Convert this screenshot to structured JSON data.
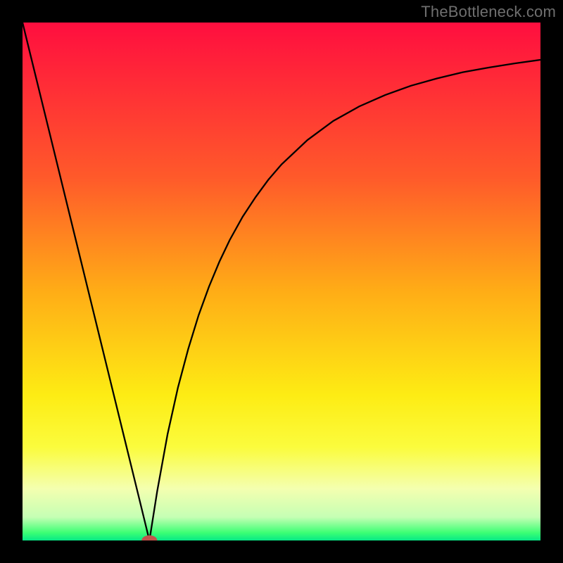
{
  "watermark": "TheBottleneck.com",
  "chart_data": {
    "type": "line",
    "title": "",
    "xlabel": "",
    "ylabel": "",
    "xlim": [
      0,
      1
    ],
    "ylim": [
      0,
      1
    ],
    "grid": false,
    "legend": false,
    "gradient_stops": [
      {
        "offset": 0.0,
        "color": "#ff0e3f"
      },
      {
        "offset": 0.3,
        "color": "#ff5a2a"
      },
      {
        "offset": 0.52,
        "color": "#ffad16"
      },
      {
        "offset": 0.72,
        "color": "#fdec14"
      },
      {
        "offset": 0.82,
        "color": "#fbfc3d"
      },
      {
        "offset": 0.9,
        "color": "#f4ffb0"
      },
      {
        "offset": 0.955,
        "color": "#c5ffb4"
      },
      {
        "offset": 0.985,
        "color": "#3cff74"
      },
      {
        "offset": 1.0,
        "color": "#06e886"
      }
    ],
    "minimum_x": 0.245,
    "series": [
      {
        "name": "bottleneck-curve",
        "color": "#000000",
        "width": 2.3,
        "x": [
          0.0,
          0.025,
          0.05,
          0.075,
          0.1,
          0.125,
          0.15,
          0.175,
          0.2,
          0.225,
          0.245,
          0.26,
          0.28,
          0.3,
          0.32,
          0.34,
          0.36,
          0.38,
          0.4,
          0.425,
          0.45,
          0.475,
          0.5,
          0.55,
          0.6,
          0.65,
          0.7,
          0.75,
          0.8,
          0.85,
          0.9,
          0.95,
          1.0
        ],
        "y": [
          1.0,
          0.898,
          0.796,
          0.694,
          0.592,
          0.49,
          0.388,
          0.286,
          0.184,
          0.082,
          0.0,
          0.095,
          0.205,
          0.295,
          0.37,
          0.435,
          0.49,
          0.538,
          0.58,
          0.625,
          0.663,
          0.697,
          0.726,
          0.773,
          0.81,
          0.838,
          0.86,
          0.878,
          0.892,
          0.904,
          0.913,
          0.921,
          0.928
        ]
      }
    ],
    "marker": {
      "x": 0.245,
      "y": 0.0,
      "rx": 0.015,
      "ry": 0.01,
      "color": "#c1544c"
    }
  }
}
